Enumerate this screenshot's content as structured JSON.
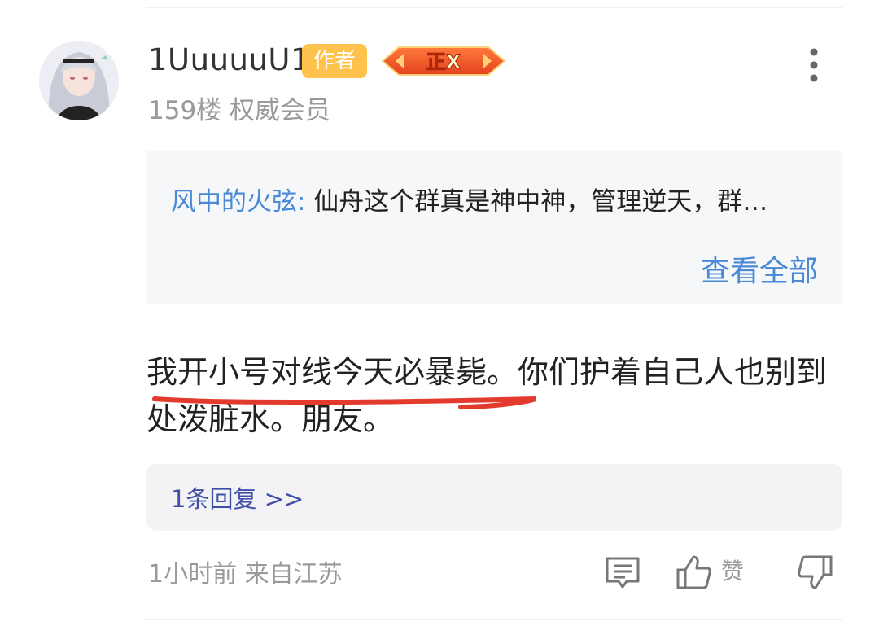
{
  "post": {
    "username": "1UuuuuU1",
    "author_badge": "作者",
    "level_badge": "正X",
    "meta": "159楼 权威会员"
  },
  "quote": {
    "author": "风中的火弦:",
    "text": " 仙舟这个群真是神中神，管理逆天，群…",
    "view_all": "查看全部"
  },
  "content": {
    "text": "我开小号对线今天必暴毙。你们护着自己人也别到处泼脏水。朋友。"
  },
  "replies": {
    "label": "1条回复 >>"
  },
  "footer": {
    "time_location": "1小时前 来自江苏",
    "like_label": "赞"
  },
  "colors": {
    "link_blue": "#4a89d6",
    "author_badge_bg": "#ffc24d",
    "underline_red": "#e23a2c"
  },
  "icons": [
    "more-vertical-icon",
    "comment-icon",
    "thumbs-up-icon",
    "thumbs-down-icon"
  ]
}
